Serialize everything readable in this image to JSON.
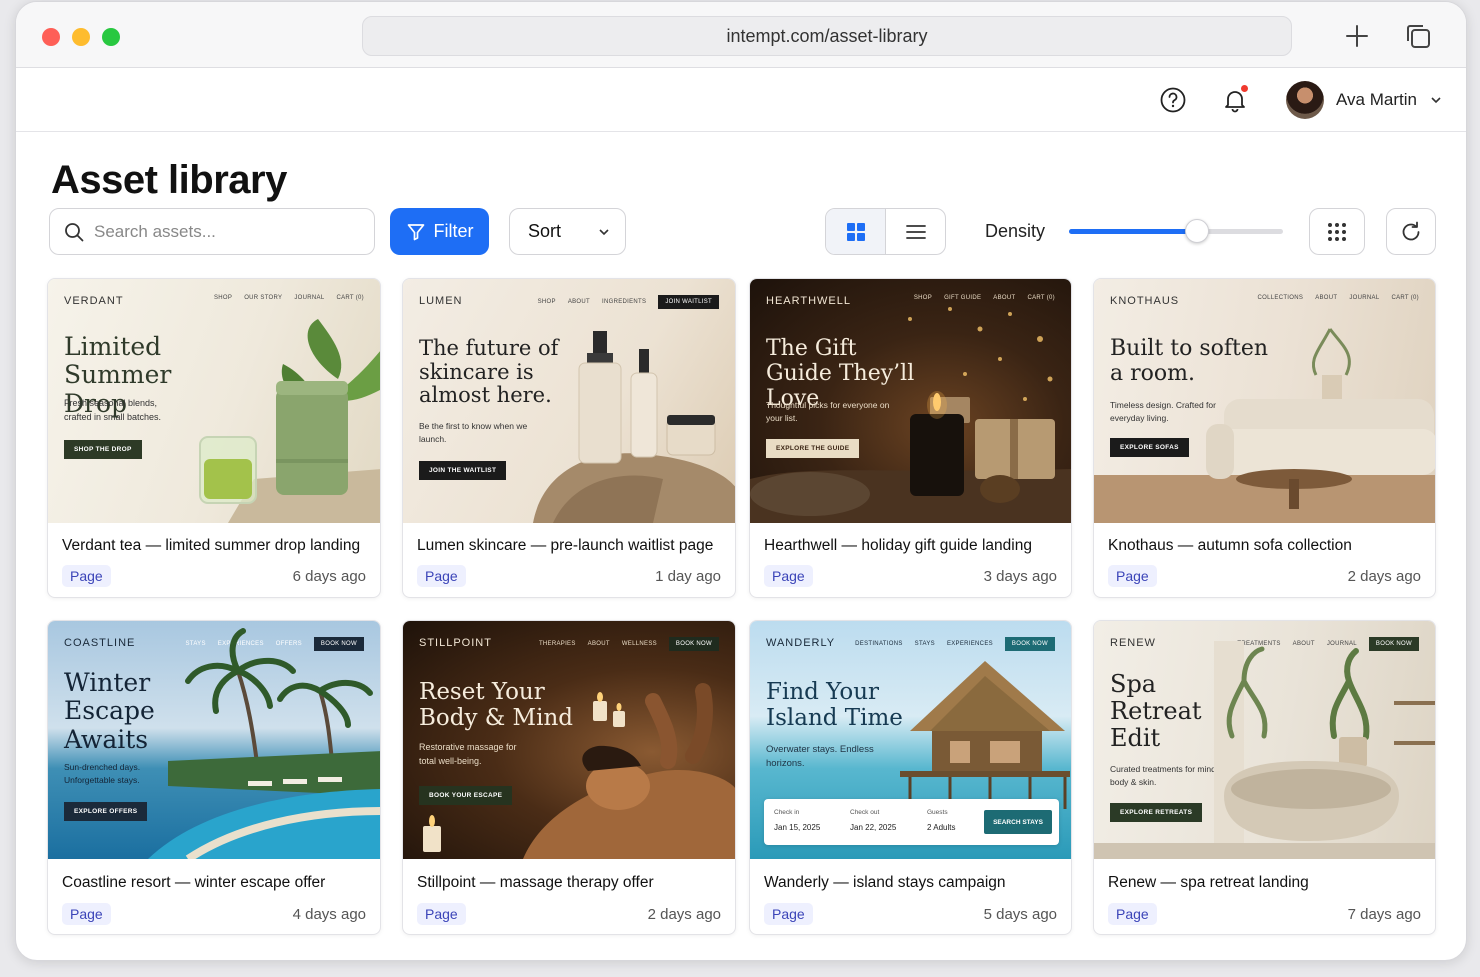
{
  "browser": {
    "url": "intempt.com/asset-library"
  },
  "header": {
    "user_name": "Ava Martin"
  },
  "page": {
    "title": "Asset library"
  },
  "toolbar": {
    "search_placeholder": "Search assets...",
    "filter_label": "Filter",
    "sort_label": "Sort",
    "density_label": "Density",
    "density_value": 0.6
  },
  "assets": [
    {
      "title": "Verdant tea — limited summer drop landing",
      "type": "Page",
      "age": "6 days ago",
      "preview": {
        "brand": "VERDANT",
        "nav": [
          "SHOP",
          "OUR STORY",
          "JOURNAL",
          "CART (0)"
        ],
        "hero": "Limited Summer Drop",
        "sub": "Fresh seasonal blends, crafted in small batches.",
        "cta": "SHOP THE DROP"
      }
    },
    {
      "title": "Lumen skincare — pre-launch waitlist page",
      "type": "Page",
      "age": "1 day ago",
      "preview": {
        "brand": "LUMEN",
        "nav": [
          "SHOP",
          "ABOUT",
          "INGREDIENTS"
        ],
        "nav_button": "JOIN WAITLIST",
        "hero": "The future of skincare is almost here.",
        "sub": "Be the first to know when we launch.",
        "cta": "JOIN THE WAITLIST"
      }
    },
    {
      "title": "Hearthwell — holiday gift guide landing",
      "type": "Page",
      "age": "3 days ago",
      "preview": {
        "brand": "HEARTHWELL",
        "nav": [
          "SHOP",
          "GIFT GUIDE",
          "ABOUT",
          "CART (0)"
        ],
        "hero": "The Gift Guide They’ll Love",
        "sub": "Thoughtful picks for everyone on your list.",
        "cta": "EXPLORE THE GUIDE"
      }
    },
    {
      "title": "Knothaus — autumn sofa collection",
      "type": "Page",
      "age": "2 days ago",
      "preview": {
        "brand": "KNOTHAUS",
        "nav": [
          "COLLECTIONS",
          "ABOUT",
          "JOURNAL",
          "CART (0)"
        ],
        "hero": "Built to soften a room.",
        "sub": "Timeless design. Crafted for everyday living.",
        "cta": "EXPLORE SOFAS"
      }
    },
    {
      "title": "Coastline resort — winter escape offer",
      "type": "Page",
      "age": "4 days ago",
      "preview": {
        "brand": "COASTLINE",
        "nav": [
          "STAYS",
          "EXPERIENCES",
          "OFFERS"
        ],
        "nav_button": "BOOK NOW",
        "hero": "Winter Escape Awaits",
        "sub": "Sun-drenched days. Unforgettable stays.",
        "cta": "EXPLORE OFFERS"
      }
    },
    {
      "title": "Stillpoint — massage therapy offer",
      "type": "Page",
      "age": "2 days ago",
      "preview": {
        "brand": "STILLPOINT",
        "nav": [
          "THERAPIES",
          "ABOUT",
          "WELLNESS"
        ],
        "nav_button": "BOOK NOW",
        "hero": "Reset Your Body & Mind",
        "sub": "Restorative massage for total well-being.",
        "cta": "BOOK YOUR ESCAPE"
      }
    },
    {
      "title": "Wanderly — island stays campaign",
      "type": "Page",
      "age": "5 days ago",
      "preview": {
        "brand": "WANDERLY",
        "nav": [
          "DESTINATIONS",
          "STAYS",
          "EXPERIENCES"
        ],
        "nav_button": "BOOK NOW",
        "hero": "Find Your Island Time",
        "sub": "Overwater stays. Endless horizons.",
        "booking": {
          "checkin_label": "Check in",
          "checkin": "Jan 15, 2025",
          "checkout_label": "Check out",
          "checkout": "Jan 22, 2025",
          "guests_label": "Guests",
          "guests": "2 Adults",
          "cta": "SEARCH STAYS"
        }
      }
    },
    {
      "title": "Renew — spa retreat landing",
      "type": "Page",
      "age": "7 days ago",
      "preview": {
        "brand": "RENEW",
        "nav": [
          "TREATMENTS",
          "ABOUT",
          "JOURNAL"
        ],
        "nav_button": "BOOK NOW",
        "hero": "Spa Retreat Edit",
        "sub": "Curated treatments for mind, body & skin.",
        "cta": "EXPLORE RETREATS"
      }
    }
  ]
}
